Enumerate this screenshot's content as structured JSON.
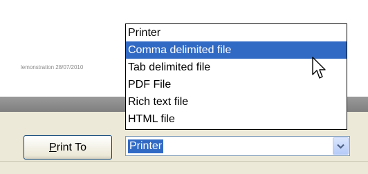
{
  "background": {
    "demo_text": "lemonstration 28/07/2010"
  },
  "colors": {
    "highlight": "#316ac5",
    "panel": "#ece9d8",
    "bar": "#8c8c8c"
  },
  "print_button": {
    "accel": "P",
    "rest": "rint To"
  },
  "combo": {
    "value": "Printer",
    "arrow_icon": "chevron-down-icon"
  },
  "dropdown": {
    "selected_index": 1,
    "items": [
      {
        "label": "Printer"
      },
      {
        "label": "Comma delimited file"
      },
      {
        "label": "Tab delimited file"
      },
      {
        "label": "PDF File"
      },
      {
        "label": "Rich text file"
      },
      {
        "label": "HTML file"
      }
    ]
  }
}
